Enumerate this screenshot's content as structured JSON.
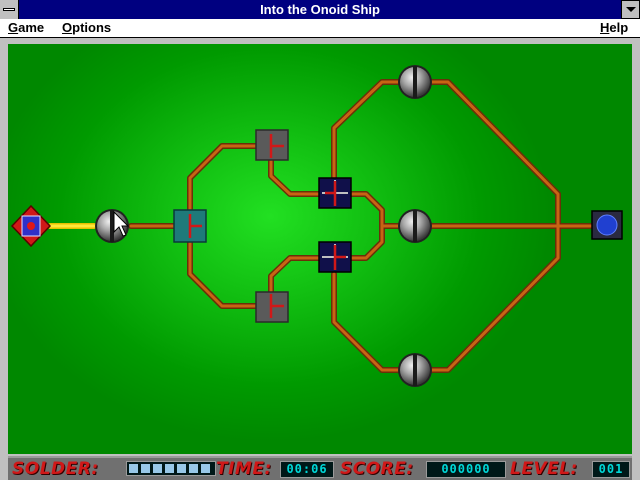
{
  "window": {
    "title": "Into the Onoid Ship"
  },
  "menu": {
    "game": "Game",
    "options": "Options",
    "help": "Help"
  },
  "status": {
    "solder_label": "SOLDER:",
    "solder_level": 1.0,
    "time_label": "TIME:",
    "time_value": "00:06",
    "score_label": "SCORE:",
    "score_value": "000000",
    "level_label": "LEVEL:",
    "level_value": "001"
  },
  "colors": {
    "board_green": "#00a000",
    "wire": "#c86414",
    "wire_highlight": "#ffe020",
    "status_label": "#d01818"
  }
}
